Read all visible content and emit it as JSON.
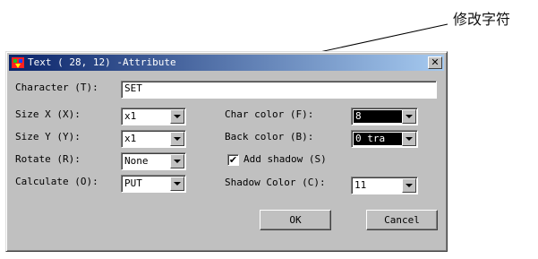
{
  "annotation": {
    "text": "修改字符"
  },
  "window": {
    "title": "Text ( 28, 12) -Attribute",
    "close_glyph": "✕"
  },
  "form": {
    "character": {
      "label": "Character (T):",
      "value": "SET"
    },
    "size_x": {
      "label": "Size X (X):",
      "value": "x1"
    },
    "size_y": {
      "label": "Size Y (Y):",
      "value": "x1"
    },
    "rotate": {
      "label": "Rotate (R):",
      "value": "None"
    },
    "calculate": {
      "label": "Calculate (O):",
      "value": "PUT"
    },
    "char_color": {
      "label": "Char color (F):",
      "value": "8"
    },
    "back_color": {
      "label": "Back color (B):",
      "value": "0 tra"
    },
    "add_shadow": {
      "label": "Add shadow (S)",
      "checked": true,
      "check_glyph": "✔"
    },
    "shadow_color": {
      "label": "Shadow Color (C):",
      "value": "11"
    }
  },
  "buttons": {
    "ok": "OK",
    "cancel": "Cancel"
  },
  "colors": {
    "title_start": "#0a246a",
    "title_end": "#a6caf0",
    "face": "#c0c0c0"
  }
}
